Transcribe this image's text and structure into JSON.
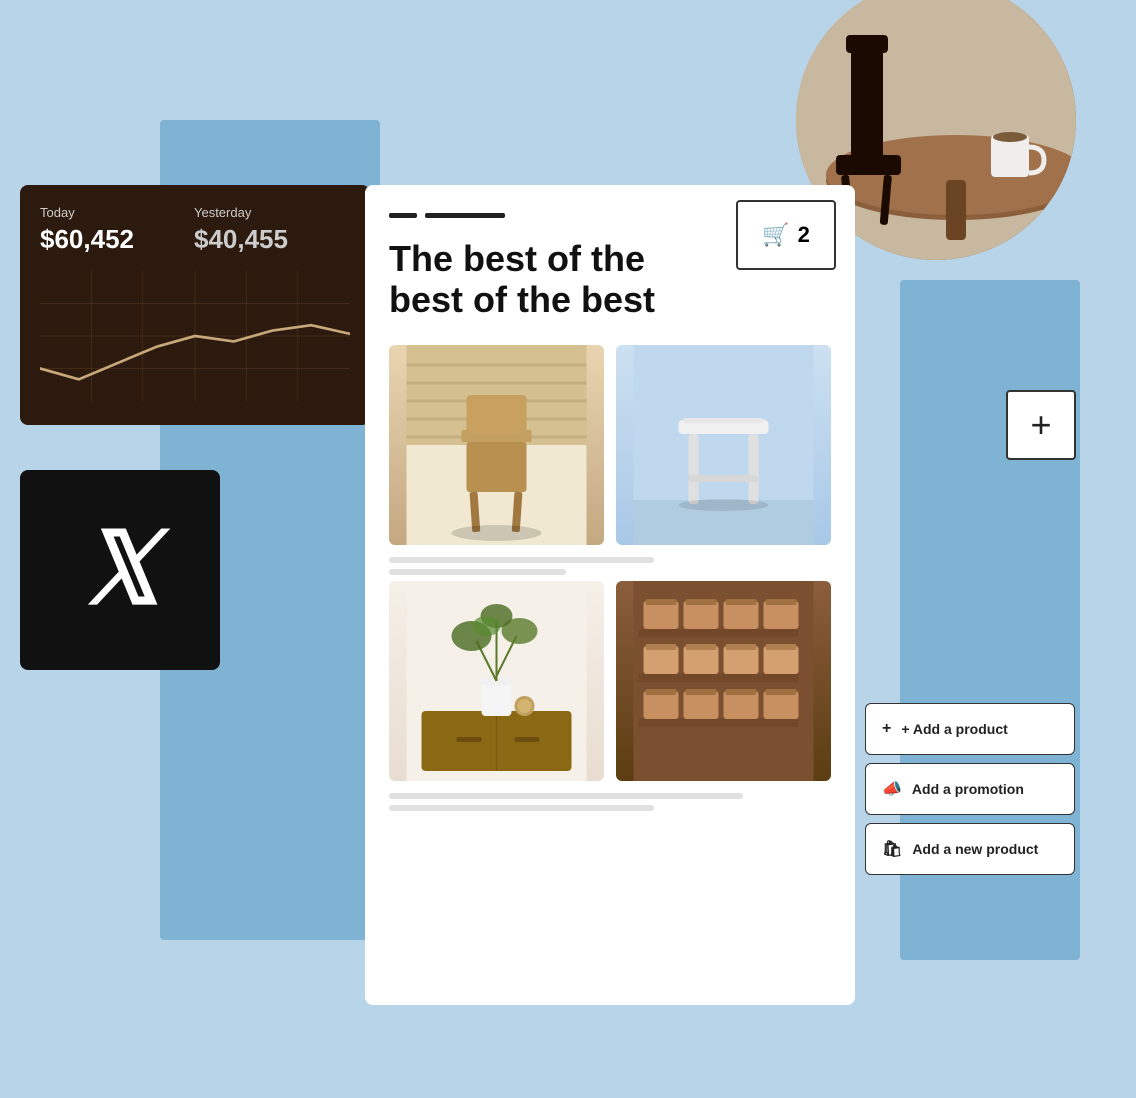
{
  "analytics": {
    "today_label": "Today",
    "today_value": "$60,452",
    "yesterday_label": "Yesterday",
    "yesterday_value": "$40,455"
  },
  "cart": {
    "count": "2"
  },
  "main": {
    "title": "The best of the\nbest of the best"
  },
  "actions": {
    "add_product_label": "+ Add a product",
    "add_promotion_label": "Add a promotion",
    "add_new_product_label": "Add a new product"
  },
  "plus_button": {
    "symbol": "+"
  },
  "icons": {
    "cart": "🛒",
    "megaphone": "📣",
    "bag": "🛍"
  }
}
